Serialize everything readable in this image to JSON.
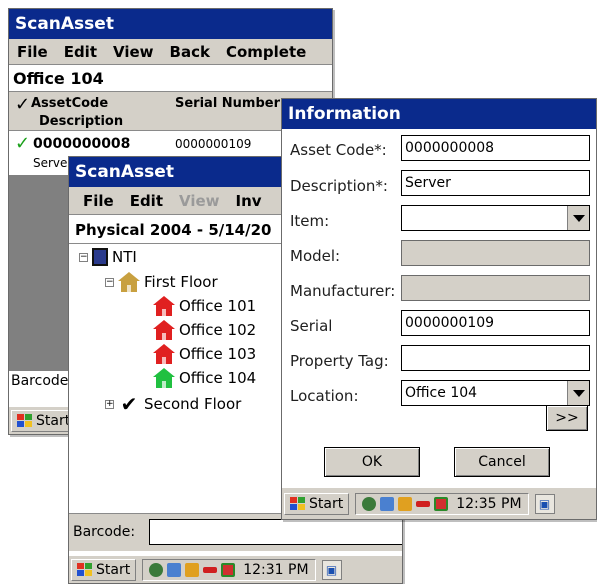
{
  "win1": {
    "title": "ScanAsset",
    "menu": [
      "File",
      "Edit",
      "View",
      "Back",
      "Complete"
    ],
    "location": "Office 104",
    "col_asset": "AssetCode",
    "col_serial": "Serial Number",
    "col_desc": "Description",
    "row_asset": "0000000008",
    "row_serial": "0000000109",
    "row_desc": "Server",
    "barcode_label": "Barcode",
    "start": "Start"
  },
  "win2": {
    "title": "ScanAsset",
    "menu": [
      "File",
      "Edit",
      "View",
      "Inv"
    ],
    "physical": "Physical 2004 - 5/14/20",
    "tree": {
      "root": "NTI",
      "first_floor": "First Floor",
      "offices": [
        "Office 101",
        "Office 102",
        "Office 103",
        "Office 104"
      ],
      "second_floor": "Second Floor"
    },
    "barcode_label": "Barcode:",
    "barcode_value": "",
    "start": "Start",
    "time": "12:31 PM"
  },
  "info": {
    "title": "Information",
    "labels": {
      "asset_code": "Asset Code*:",
      "description": "Description*:",
      "item": "Item:",
      "model": "Model:",
      "manufacturer": "Manufacturer:",
      "serial": "Serial",
      "property_tag": "Property Tag:",
      "location": "Location:"
    },
    "values": {
      "asset_code": "0000000008",
      "description": "Server",
      "item": "",
      "model": "",
      "manufacturer": "",
      "serial": "0000000109",
      "property_tag": "",
      "location": "Office 104"
    },
    "more": ">>",
    "ok": "OK",
    "cancel": "Cancel",
    "start": "Start",
    "time": "12:35 PM"
  },
  "colors": {
    "titlebar": "#0a2a8c",
    "office_red": "#e02020",
    "office_green": "#20c040",
    "check_green": "#1aa01a"
  }
}
